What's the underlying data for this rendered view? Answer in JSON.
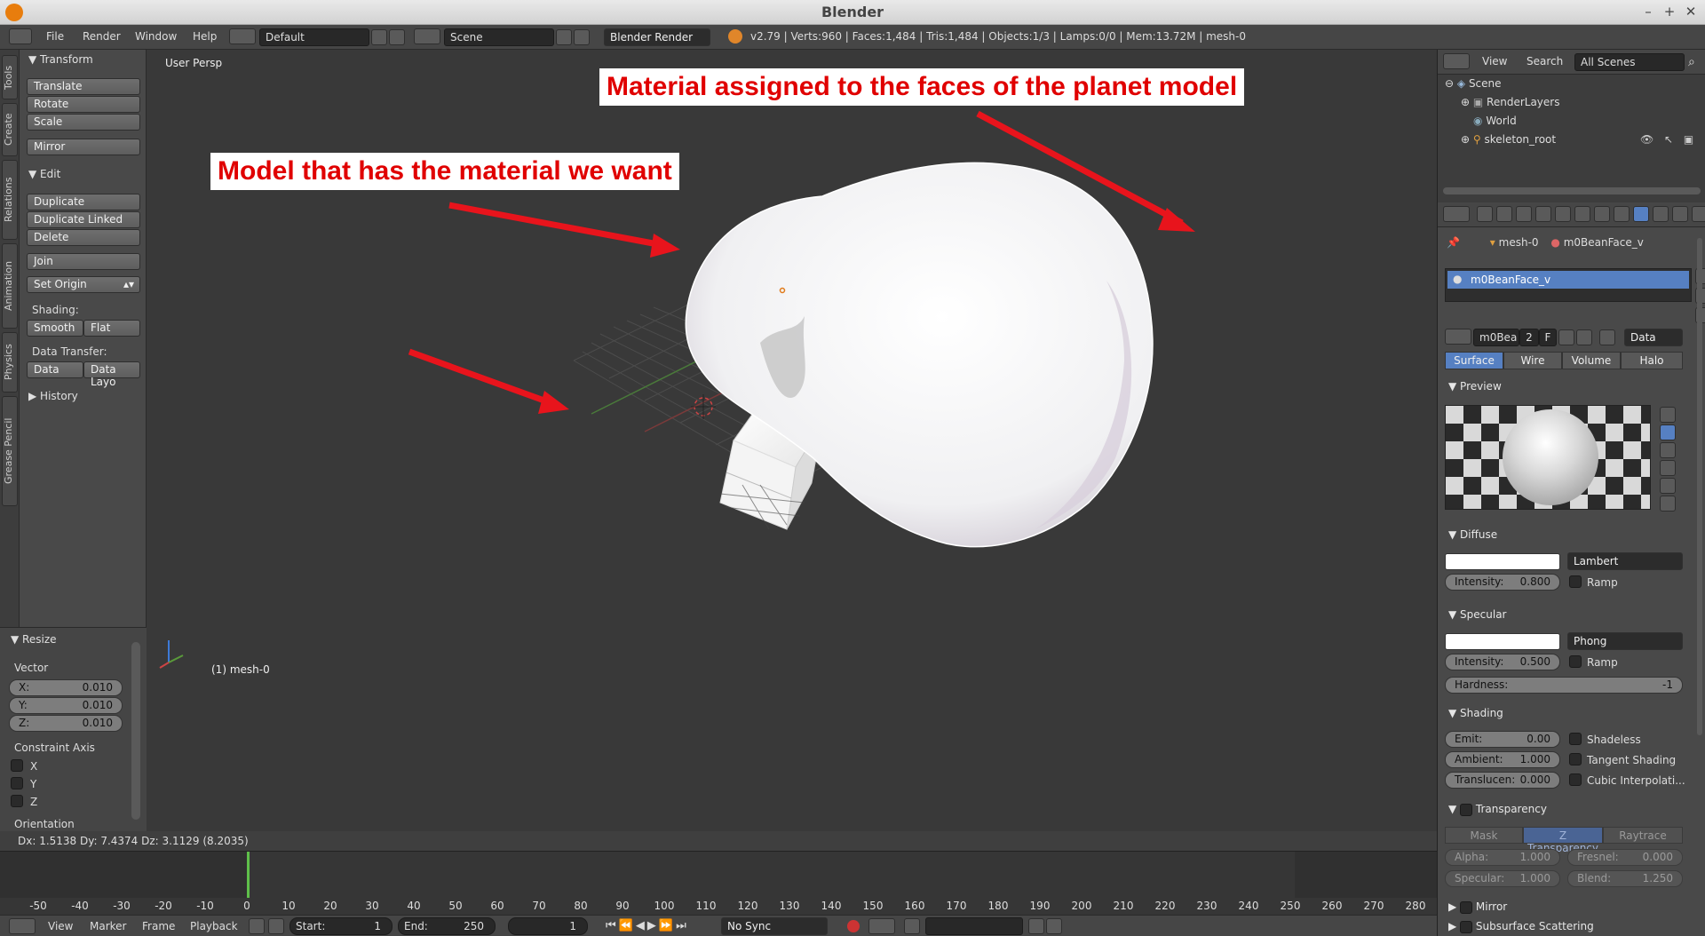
{
  "window": {
    "title": "Blender",
    "minimize": "–",
    "maximize": "+",
    "close": "✕"
  },
  "menubar": {
    "menus": [
      "File",
      "Render",
      "Window",
      "Help"
    ],
    "layout": "Default",
    "scene": "Scene",
    "engine": "Blender Render",
    "stats": "v2.79 | Verts:960 | Faces:1,484 | Tris:1,484 | Objects:1/3 | Lamps:0/0 | Mem:13.72M | mesh-0"
  },
  "left_tabs": [
    "Tools",
    "Create",
    "Relations",
    "Animation",
    "Physics",
    "Grease Pencil"
  ],
  "toolshelf": {
    "transform_header": "Transform",
    "translate": "Translate",
    "rotate": "Rotate",
    "scale": "Scale",
    "mirror": "Mirror",
    "edit_header": "Edit",
    "duplicate": "Duplicate",
    "duplicate_linked": "Duplicate Linked",
    "delete": "Delete",
    "join": "Join",
    "set_origin": "Set Origin",
    "shading_label": "Shading:",
    "smooth": "Smooth",
    "flat": "Flat",
    "data_transfer_label": "Data Transfer:",
    "data": "Data",
    "data_layo": "Data Layo",
    "history_header": "History"
  },
  "operator_panel": {
    "header": "Resize",
    "vector_label": "Vector",
    "x_label": "X:",
    "x_value": "0.010",
    "y_label": "Y:",
    "y_value": "0.010",
    "z_label": "Z:",
    "z_value": "0.010",
    "constraint_label": "Constraint Axis",
    "cx": "X",
    "cy": "Y",
    "cz": "Z",
    "orientation_label": "Orientation"
  },
  "viewport": {
    "view_label": "User Persp",
    "object_label": "(1) mesh-0",
    "annotation_1": "Material assigned to the faces of the planet model",
    "annotation_2": "Model that has the material we want",
    "mesh_color": "#f2f2f2",
    "arrow_color": "#e8141c"
  },
  "status": {
    "text": "Dx: 1.5138   Dy: 7.4374   Dz: 3.1129 (8.2035)"
  },
  "timeline": {
    "ticks": [
      "-50",
      "-40",
      "-30",
      "-20",
      "-10",
      "0",
      "10",
      "20",
      "30",
      "40",
      "50",
      "60",
      "70",
      "80",
      "90",
      "100",
      "110",
      "120",
      "130",
      "140",
      "150",
      "160",
      "170",
      "180",
      "190",
      "200",
      "210",
      "220",
      "230",
      "240",
      "250",
      "260",
      "270",
      "280"
    ]
  },
  "bottombar": {
    "view": "View",
    "marker": "Marker",
    "frame": "Frame",
    "playback": "Playback",
    "start_label": "Start:",
    "start_value": "1",
    "end_label": "End:",
    "end_value": "250",
    "current_frame": "1",
    "sync": "No Sync"
  },
  "outliner": {
    "view": "View",
    "search": "Search",
    "filter": "All Scenes",
    "items": [
      "Scene",
      "RenderLayers",
      "World",
      "skeleton_root"
    ]
  },
  "properties": {
    "breadcrumb_mesh": "mesh-0",
    "breadcrumb_material": "m0BeanFace_v",
    "slot_name": "m0BeanFace_v",
    "mat_name": "m0Bea",
    "mat_users": "2",
    "fake_user": "F",
    "link": "Data",
    "tabs": [
      "Surface",
      "Wire",
      "Volume",
      "Halo"
    ],
    "preview_header": "Preview",
    "diffuse_header": "Diffuse",
    "diffuse_shader": "Lambert",
    "diffuse_intensity_label": "Intensity:",
    "diffuse_intensity": "0.800",
    "ramp": "Ramp",
    "specular_header": "Specular",
    "specular_shader": "Phong",
    "specular_intensity_label": "Intensity:",
    "specular_intensity": "0.500",
    "hardness_label": "Hardness:",
    "hardness": "-1",
    "shading_header": "Shading",
    "emit_label": "Emit:",
    "emit": "0.00",
    "ambient_label": "Ambient:",
    "ambient": "1.000",
    "transluc_label": "Translucen:",
    "transluc": "0.000",
    "shadeless": "Shadeless",
    "tangent": "Tangent Shading",
    "cubic": "Cubic Interpolati...",
    "transparency_header": "Transparency",
    "trans_tabs": [
      "Mask",
      "Z Transparency",
      "Raytrace"
    ],
    "alpha_label": "Alpha:",
    "alpha": "1.000",
    "fresnel_label": "Fresnel:",
    "fresnel": "0.000",
    "spec_label": "Specular:",
    "spec": "1.000",
    "blend_label": "Blend:",
    "blend": "1.250",
    "mirror_header": "Mirror",
    "sss_header": "Subsurface Scattering",
    "accent": "#5680c2"
  }
}
